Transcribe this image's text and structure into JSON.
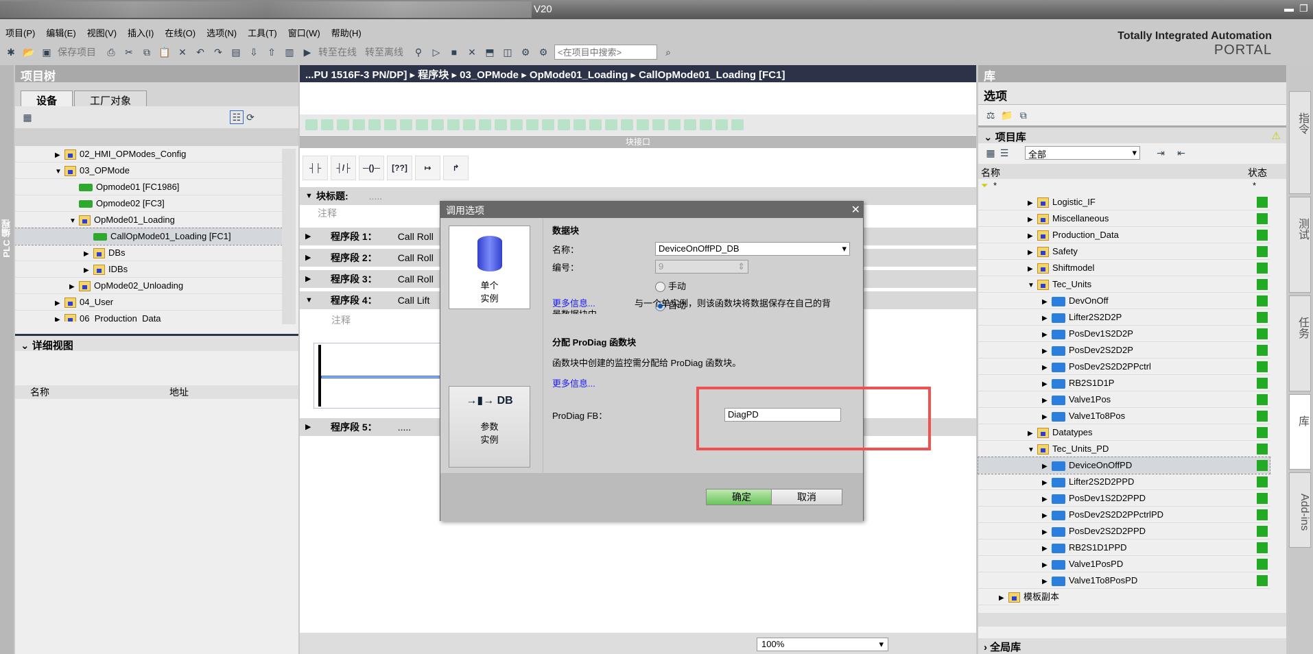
{
  "window": {
    "title": "V20",
    "brand1": "Totally Integrated Automation",
    "brand2": "PORTAL"
  },
  "menu": [
    "项目(P)",
    "编辑(E)",
    "视图(V)",
    "插入(I)",
    "在线(O)",
    "选项(N)",
    "工具(T)",
    "窗口(W)",
    "帮助(H)"
  ],
  "toolbar": {
    "save": "保存项目",
    "go_online": "转至在线",
    "go_offline": "转至离线",
    "search_placeholder": "<在项目中搜索>"
  },
  "project_tree": {
    "title": "项目树",
    "tabs": [
      "设备",
      "工厂对象"
    ],
    "side_label": "PLC 编程",
    "items": [
      {
        "label": "02_HMI_OPModes_Config",
        "indent": 0,
        "type": "folder",
        "exp": "closed"
      },
      {
        "label": "03_OPMode",
        "indent": 0,
        "type": "folder",
        "exp": "open"
      },
      {
        "label": "Opmode01 [FC1986]",
        "indent": 1,
        "type": "fc",
        "exp": ""
      },
      {
        "label": "Opmode02 [FC3]",
        "indent": 1,
        "type": "fc",
        "exp": ""
      },
      {
        "label": "OpMode01_Loading",
        "indent": 1,
        "type": "folder",
        "exp": "open"
      },
      {
        "label": "CallOpMode01_Loading [FC1]",
        "indent": 2,
        "type": "fc",
        "exp": "",
        "selected": true
      },
      {
        "label": "DBs",
        "indent": 2,
        "type": "folder",
        "exp": "closed"
      },
      {
        "label": "IDBs",
        "indent": 2,
        "type": "folder",
        "exp": "closed"
      },
      {
        "label": "OpMode02_Unloading",
        "indent": 1,
        "type": "folder",
        "exp": "closed"
      },
      {
        "label": "04_User",
        "indent": 0,
        "type": "folder",
        "exp": "closed"
      },
      {
        "label": "06_Production_Data",
        "indent": 0,
        "type": "folder",
        "exp": "closed"
      }
    ],
    "detail_view": "详细视图",
    "detail_cols": [
      "名称",
      "地址"
    ]
  },
  "editor": {
    "breadcrumb": [
      "...PU 1516F-3 PN/DP]",
      "程序块",
      "03_OPMode",
      "OpMode01_Loading",
      "CallOpMode01_Loading [FC1]"
    ],
    "interface_label": "块接口",
    "block_title": "块标题:",
    "block_title_dots": ".....",
    "comment": "注释",
    "networks": [
      {
        "label": "程序段 1：",
        "text": "Call Roll"
      },
      {
        "label": "程序段 2：",
        "text": "Call Roll"
      },
      {
        "label": "程序段 3：",
        "text": "Call Roll"
      },
      {
        "label": "程序段 4：",
        "text": "Call Lift"
      },
      {
        "label": "程序段 5：",
        "text": "....."
      }
    ],
    "zoom": "100%"
  },
  "dialog": {
    "title": "调用选项",
    "single": "单个\n实例",
    "multi": "参数\n实例",
    "db_section": "数据块",
    "name_label": "名称：",
    "name_value": "DeviceOnOffPD_DB",
    "number_label": "编号：",
    "number_value": "9",
    "manual": "手动",
    "auto": "自动",
    "more_info": "更多信息...",
    "desc1": "与一个单实例，则该函数块将数据保存在自己的背",
    "desc2": "景数据块中。",
    "prodiag_section": "分配 ProDiag 函数块",
    "prodiag_desc": "函数块中创建的监控需分配给 ProDiag 函数块。",
    "more_info2": "更多信息...",
    "prodiag_fb_label": "ProDiag FB：",
    "prodiag_fb_value": "DiagPD",
    "ok": "确定",
    "cancel": "取消",
    "highlight_color": "#f05050"
  },
  "library": {
    "title": "库",
    "options": "选项",
    "project_lib": "项目库",
    "filter": "全部",
    "col_name": "名称",
    "col_status": "状态",
    "filter_star": "*",
    "items": [
      {
        "label": "Logistic_IF",
        "indent": 0,
        "type": "folder",
        "exp": "closed"
      },
      {
        "label": "Miscellaneous",
        "indent": 0,
        "type": "folder",
        "exp": "closed"
      },
      {
        "label": "Production_Data",
        "indent": 0,
        "type": "folder",
        "exp": "closed"
      },
      {
        "label": "Safety",
        "indent": 0,
        "type": "folder",
        "exp": "closed"
      },
      {
        "label": "Shiftmodel",
        "indent": 0,
        "type": "folder",
        "exp": "closed"
      },
      {
        "label": "Tec_Units",
        "indent": 0,
        "type": "folder",
        "exp": "open"
      },
      {
        "label": "DevOnOff",
        "indent": 1,
        "type": "fb",
        "exp": "closed"
      },
      {
        "label": "Lifter2S2D2P",
        "indent": 1,
        "type": "fb",
        "exp": "closed"
      },
      {
        "label": "PosDev1S2D2P",
        "indent": 1,
        "type": "fb",
        "exp": "closed"
      },
      {
        "label": "PosDev2S2D2P",
        "indent": 1,
        "type": "fb",
        "exp": "closed"
      },
      {
        "label": "PosDev2S2D2PPctrl",
        "indent": 1,
        "type": "fb",
        "exp": "closed"
      },
      {
        "label": "RB2S1D1P",
        "indent": 1,
        "type": "fb",
        "exp": "closed"
      },
      {
        "label": "Valve1Pos",
        "indent": 1,
        "type": "fb",
        "exp": "closed"
      },
      {
        "label": "Valve1To8Pos",
        "indent": 1,
        "type": "fb",
        "exp": "closed"
      },
      {
        "label": "Datatypes",
        "indent": 0,
        "type": "folder",
        "exp": "closed"
      },
      {
        "label": "Tec_Units_PD",
        "indent": 0,
        "type": "folder",
        "exp": "open"
      },
      {
        "label": "DeviceOnOffPD",
        "indent": 1,
        "type": "fb",
        "exp": "closed",
        "selected": true
      },
      {
        "label": "Lifter2S2D2PPD",
        "indent": 1,
        "type": "fb",
        "exp": "closed"
      },
      {
        "label": "PosDev1S2D2PPD",
        "indent": 1,
        "type": "fb",
        "exp": "closed"
      },
      {
        "label": "PosDev2S2D2PPctrlPD",
        "indent": 1,
        "type": "fb",
        "exp": "closed"
      },
      {
        "label": "PosDev2S2D2PPD",
        "indent": 1,
        "type": "fb",
        "exp": "closed"
      },
      {
        "label": "RB2S1D1PPD",
        "indent": 1,
        "type": "fb",
        "exp": "closed"
      },
      {
        "label": "Valve1PosPD",
        "indent": 1,
        "type": "fb",
        "exp": "closed"
      },
      {
        "label": "Valve1To8PosPD",
        "indent": 1,
        "type": "fb",
        "exp": "closed"
      }
    ],
    "template": "模板副本",
    "global": "全局库",
    "status_color": "#22aa22"
  },
  "side_tabs": [
    "指令",
    "测试",
    "任务",
    "库",
    "Add-ins"
  ]
}
